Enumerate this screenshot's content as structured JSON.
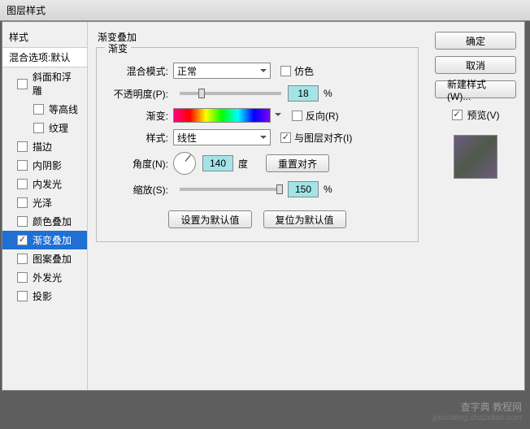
{
  "window": {
    "title": "图层样式"
  },
  "left": {
    "styles_label": "样式",
    "blend_options": "混合选项:默认",
    "items": [
      {
        "label": "斜面和浮雕",
        "checked": false
      },
      {
        "label": "等高线",
        "checked": false,
        "indent": true
      },
      {
        "label": "纹理",
        "checked": false,
        "indent": true
      },
      {
        "label": "描边",
        "checked": false
      },
      {
        "label": "内阴影",
        "checked": false
      },
      {
        "label": "内发光",
        "checked": false
      },
      {
        "label": "光泽",
        "checked": false
      },
      {
        "label": "颜色叠加",
        "checked": false
      },
      {
        "label": "渐变叠加",
        "checked": true,
        "selected": true
      },
      {
        "label": "图案叠加",
        "checked": false
      },
      {
        "label": "外发光",
        "checked": false
      },
      {
        "label": "投影",
        "checked": false
      }
    ]
  },
  "panel": {
    "title": "渐变叠加",
    "fieldset": "渐变",
    "blend_mode_label": "混合模式:",
    "blend_mode_value": "正常",
    "dither_label": "仿色",
    "opacity_label": "不透明度(P):",
    "opacity_value": "18",
    "opacity_unit": "%",
    "gradient_label": "渐变:",
    "reverse_label": "反向(R)",
    "style_label": "样式:",
    "style_value": "线性",
    "align_label": "与图层对齐(I)",
    "angle_label": "角度(N):",
    "angle_value": "140",
    "angle_unit": "度",
    "reset_align": "重置对齐",
    "scale_label": "缩放(S):",
    "scale_value": "150",
    "scale_unit": "%",
    "set_default": "设置为默认值",
    "reset_default": "复位为默认值"
  },
  "right": {
    "ok": "确定",
    "cancel": "取消",
    "new_style": "新建样式(W)...",
    "preview": "预览(V)"
  },
  "watermark": {
    "main": "查字典 教程网",
    "sub": "jiaocheng.chazidian.com"
  }
}
